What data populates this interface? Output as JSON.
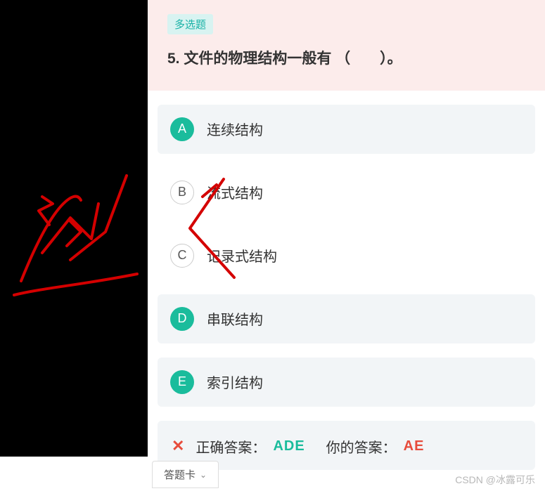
{
  "question": {
    "type_tag": "多选题",
    "number": "5.",
    "title": "5. 文件的物理结构一般有 （　　）。"
  },
  "options": [
    {
      "key": "A",
      "text": "连续结构",
      "style": "green",
      "shaded": true
    },
    {
      "key": "B",
      "text": "流式结构",
      "style": "outline",
      "shaded": false
    },
    {
      "key": "C",
      "text": "记录式结构",
      "style": "outline",
      "shaded": false
    },
    {
      "key": "D",
      "text": "串联结构",
      "style": "green",
      "shaded": true
    },
    {
      "key": "E",
      "text": "索引结构",
      "style": "green",
      "shaded": true
    }
  ],
  "answers": {
    "correct_label": "正确答案：",
    "correct_value": "ADE",
    "your_label": "你的答案：",
    "your_value": "AE"
  },
  "footer": {
    "answer_card": "答题卡",
    "watermark": "CSDN @冰露可乐"
  }
}
